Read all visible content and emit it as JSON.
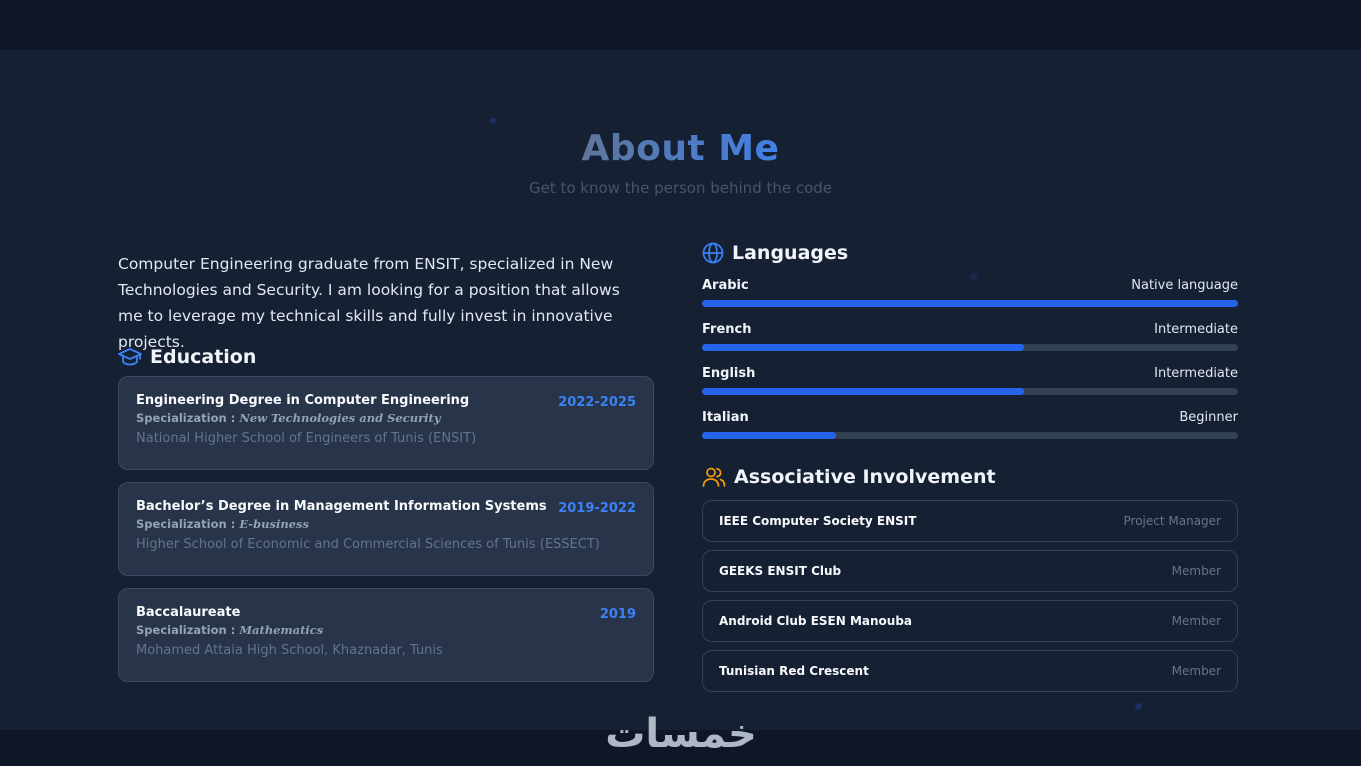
{
  "header": {
    "title": "About Me",
    "subtitle": "Get to know the person behind the code"
  },
  "intro": "Computer Engineering graduate from ENSIT, specialized in New Technologies and Security. I am looking for a position that allows me to leverage my technical skills and fully invest in innovative projects.",
  "education": {
    "heading": "Education",
    "spec_label": "Specialization :",
    "items": [
      {
        "title": "Engineering Degree in Computer Engineering",
        "years": "2022-2025",
        "specialization": "New Technologies and Security",
        "school": "National Higher School of Engineers of Tunis (ENSIT)"
      },
      {
        "title": "Bachelor’s Degree in Management Information Systems",
        "years": "2019-2022",
        "specialization": "E-business",
        "school": "Higher School of Economic and Commercial Sciences of Tunis (ESSECT)"
      },
      {
        "title": "Baccalaureate",
        "years": "2019",
        "specialization": "Mathematics",
        "school": "Mohamed Attaia High School, Khaznadar, Tunis"
      }
    ]
  },
  "languages": {
    "heading": "Languages",
    "items": [
      {
        "name": "Arabic",
        "level": "Native language",
        "progress": 1.0
      },
      {
        "name": "French",
        "level": "Intermediate",
        "progress": 0.6
      },
      {
        "name": "English",
        "level": "Intermediate",
        "progress": 0.6
      },
      {
        "name": "Italian",
        "level": "Beginner",
        "progress": 0.25
      }
    ]
  },
  "associative": {
    "heading": "Associative Involvement",
    "items": [
      {
        "name": "IEEE Computer Society ENSIT",
        "role": "Project Manager"
      },
      {
        "name": "GEEKS ENSIT Club",
        "role": "Member"
      },
      {
        "name": "Android Club ESEN Manouba",
        "role": "Member"
      },
      {
        "name": "Tunisian Red Crescent",
        "role": "Member"
      }
    ]
  },
  "watermark": "خمسات",
  "colors": {
    "accent": "#2563eb",
    "accent_text": "#3b82f6",
    "icon_orange": "#f59e0b"
  },
  "icons": {
    "education": "graduation-cap-icon",
    "languages": "globe-icon",
    "associative": "users-icon"
  }
}
